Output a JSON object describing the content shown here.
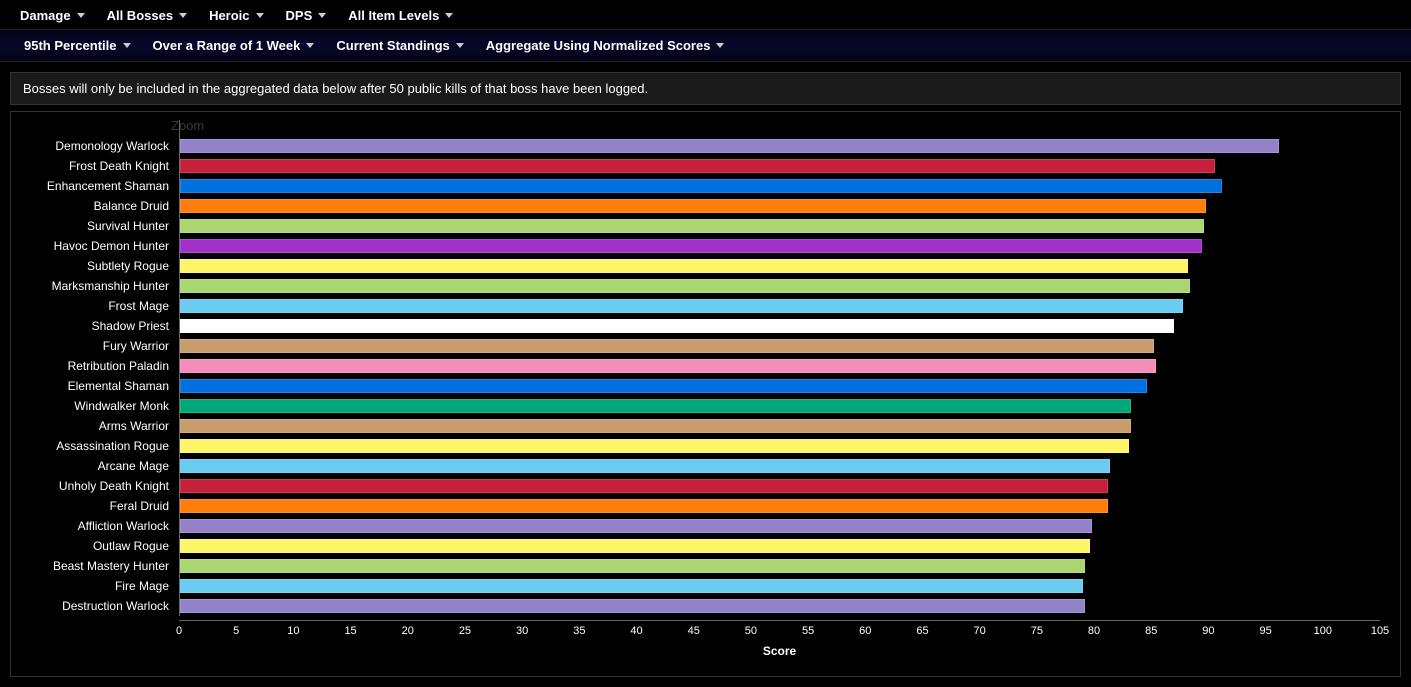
{
  "topbar": {
    "damage": "Damage",
    "all_bosses": "All Bosses",
    "difficulty": "Heroic",
    "role": "DPS",
    "ilvl": "All Item Levels"
  },
  "filterbar": {
    "percentile": "95th Percentile",
    "range": "Over a Range of 1 Week",
    "standings": "Current Standings",
    "aggregate": "Aggregate Using Normalized Scores"
  },
  "notice": "Bosses will only be included in the aggregated data below after 50 public kills of that boss have been logged.",
  "zoom": "Zoom",
  "xlabel": "Score",
  "chart_data": {
    "type": "bar",
    "xlabel": "Score",
    "xlim": [
      0,
      105
    ],
    "xticks": [
      0,
      5,
      10,
      15,
      20,
      25,
      30,
      35,
      40,
      45,
      50,
      55,
      60,
      65,
      70,
      75,
      80,
      85,
      90,
      95,
      100,
      105
    ],
    "series": [
      {
        "name": "Demonology Warlock",
        "value": 96.2,
        "color": "#9482c9"
      },
      {
        "name": "Frost Death Knight",
        "value": 90.6,
        "color": "#c41f3b"
      },
      {
        "name": "Enhancement Shaman",
        "value": 91.2,
        "color": "#0070de"
      },
      {
        "name": "Balance Druid",
        "value": 89.8,
        "color": "#ff7d0a"
      },
      {
        "name": "Survival Hunter",
        "value": 89.6,
        "color": "#abd473"
      },
      {
        "name": "Havoc Demon Hunter",
        "value": 89.4,
        "color": "#a330c9"
      },
      {
        "name": "Subtlety Rogue",
        "value": 88.2,
        "color": "#fff569"
      },
      {
        "name": "Marksmanship Hunter",
        "value": 88.4,
        "color": "#abd473"
      },
      {
        "name": "Frost Mage",
        "value": 87.8,
        "color": "#69ccf0"
      },
      {
        "name": "Shadow Priest",
        "value": 87.0,
        "color": "#ffffff"
      },
      {
        "name": "Fury Warrior",
        "value": 85.2,
        "color": "#c79c6e"
      },
      {
        "name": "Retribution Paladin",
        "value": 85.4,
        "color": "#f58cba"
      },
      {
        "name": "Elemental Shaman",
        "value": 84.6,
        "color": "#0070de"
      },
      {
        "name": "Windwalker Monk",
        "value": 83.2,
        "color": "#00a878"
      },
      {
        "name": "Arms Warrior",
        "value": 83.2,
        "color": "#c79c6e"
      },
      {
        "name": "Assassination Rogue",
        "value": 83.0,
        "color": "#fff569"
      },
      {
        "name": "Arcane Mage",
        "value": 81.4,
        "color": "#69ccf0"
      },
      {
        "name": "Unholy Death Knight",
        "value": 81.2,
        "color": "#c41f3b"
      },
      {
        "name": "Feral Druid",
        "value": 81.2,
        "color": "#ff7d0a"
      },
      {
        "name": "Affliction Warlock",
        "value": 79.8,
        "color": "#9482c9"
      },
      {
        "name": "Outlaw Rogue",
        "value": 79.6,
        "color": "#fff569"
      },
      {
        "name": "Beast Mastery Hunter",
        "value": 79.2,
        "color": "#abd473"
      },
      {
        "name": "Fire Mage",
        "value": 79.0,
        "color": "#69ccf0"
      },
      {
        "name": "Destruction Warlock",
        "value": 79.2,
        "color": "#9482c9"
      }
    ]
  }
}
